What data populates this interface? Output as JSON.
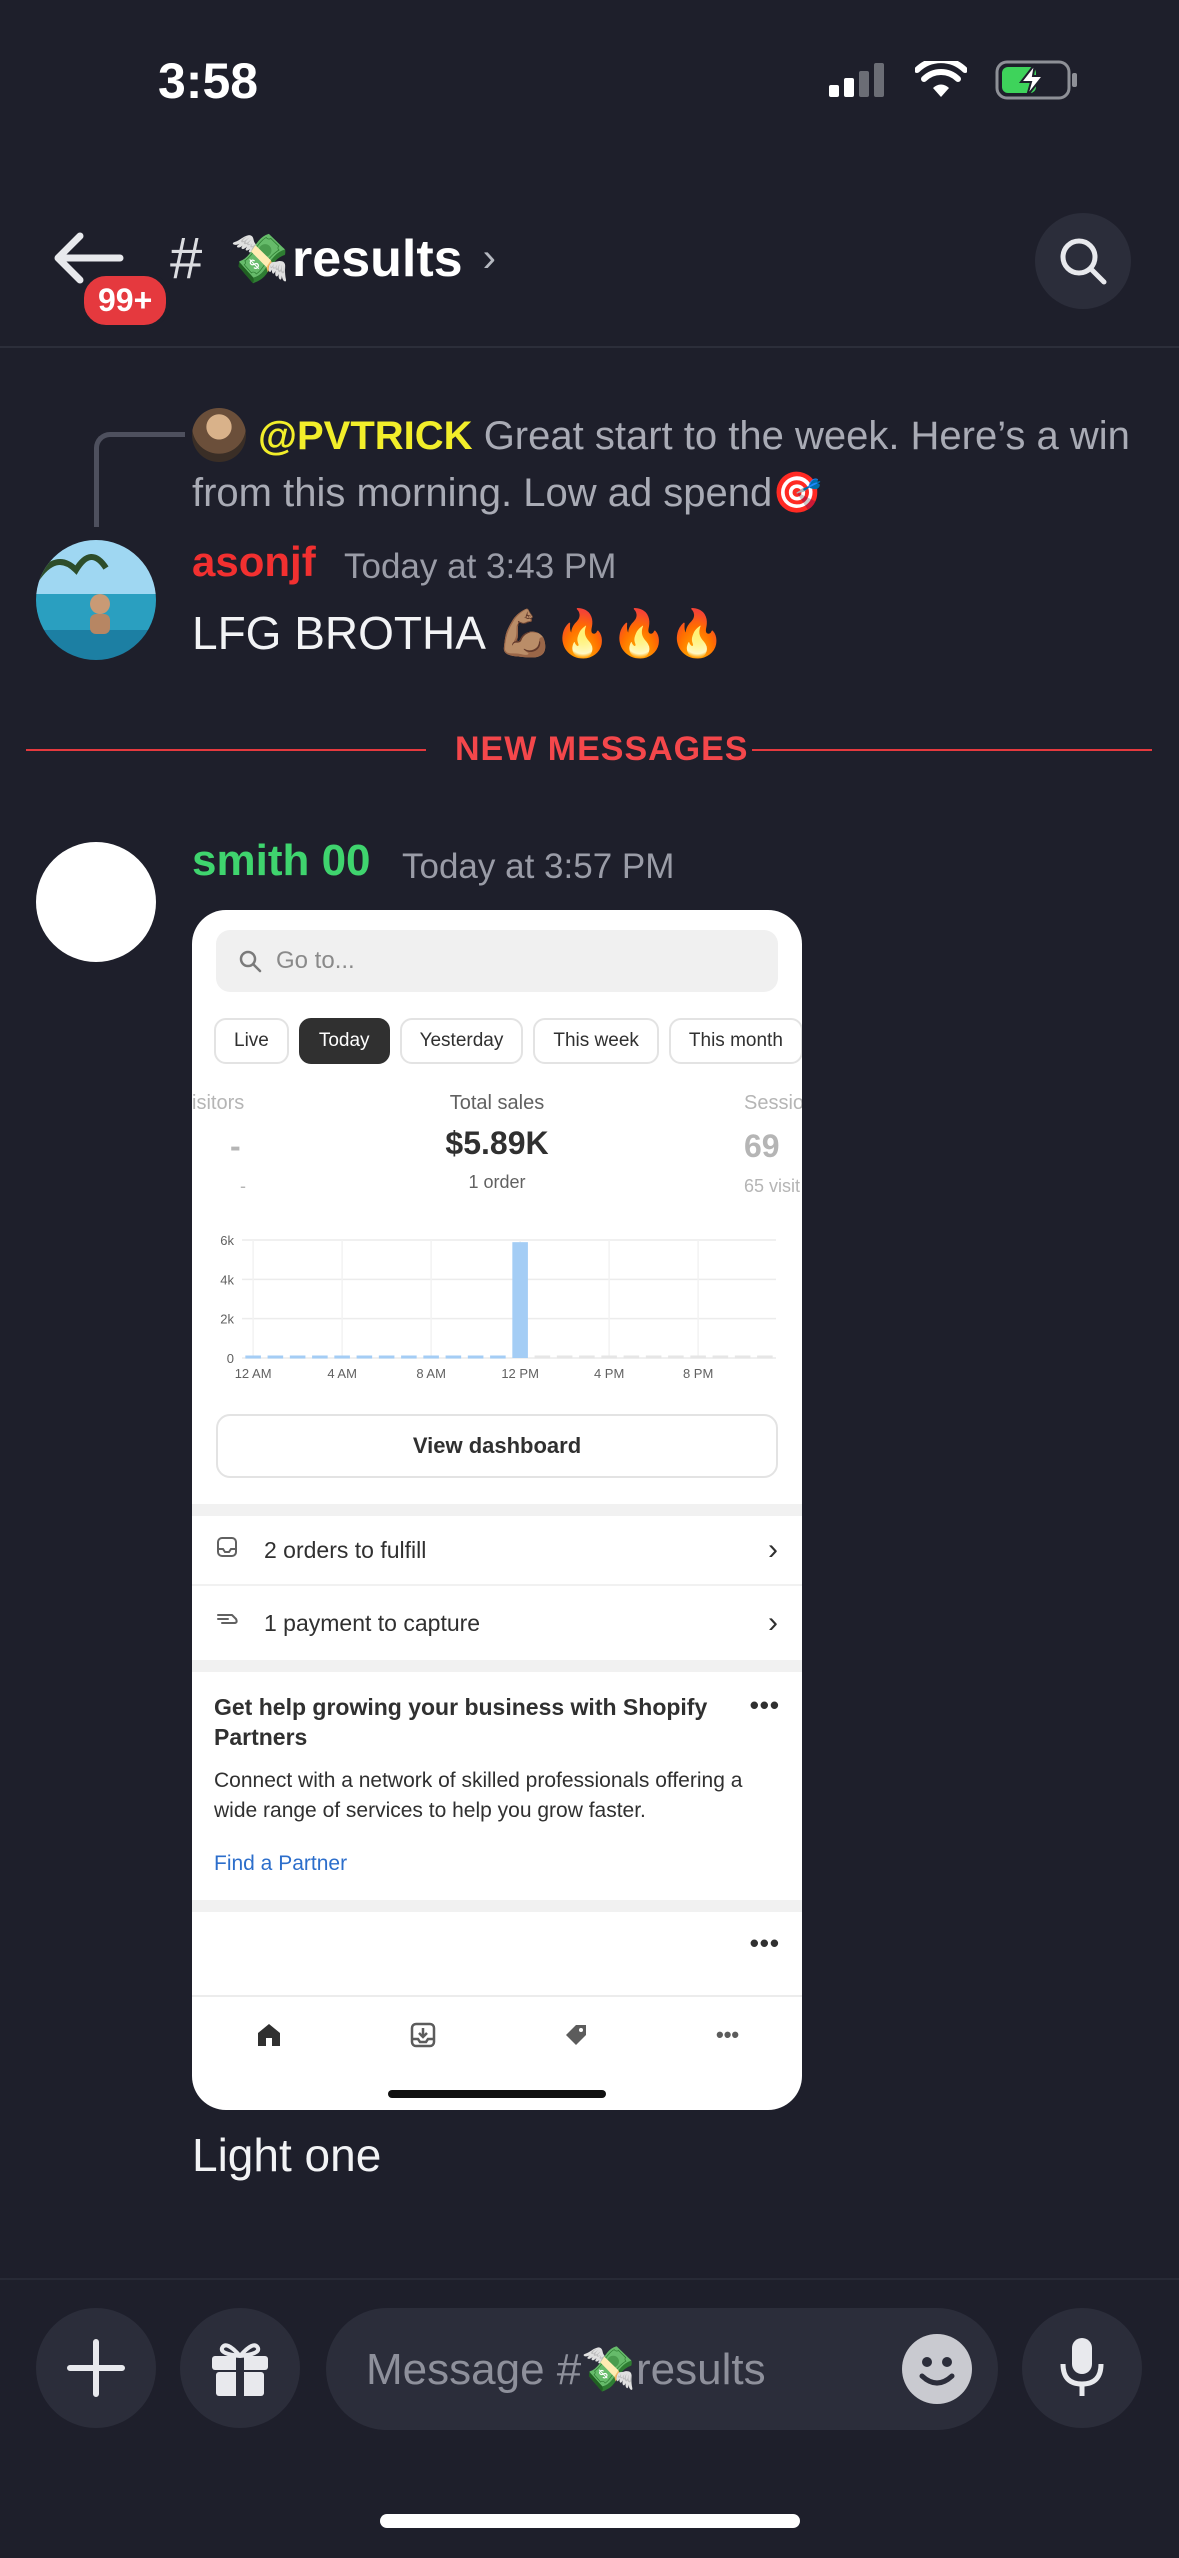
{
  "status_bar": {
    "time": "3:58"
  },
  "header": {
    "unread_badge": "99+",
    "channel_hash": "#",
    "channel_emoji": "💸",
    "channel_name": "results",
    "chevron": "›"
  },
  "reply": {
    "mention": "@PVTRICK",
    "text": " Great start to the week. Here’s a win from this morning. Low ad spend🎯"
  },
  "messages": [
    {
      "author": "asonjf",
      "author_color": "#f23030",
      "timestamp": "Today at 3:43 PM",
      "text": "LFG BROTHA 💪🏽🔥🔥🔥"
    },
    {
      "author": "smith 00",
      "author_color": "#3fd46e",
      "timestamp": "Today at 3:57 PM",
      "text": "Light one"
    }
  ],
  "divider": {
    "label": "NEW MESSAGES"
  },
  "screenshot": {
    "search_placeholder": "Go to...",
    "tabs": [
      "Live",
      "Today",
      "Yesterday",
      "This week",
      "This month"
    ],
    "active_tab": "Today",
    "metrics": [
      {
        "label": "isitors",
        "value": "-",
        "sub": "-"
      },
      {
        "label": "Total sales",
        "value": "$5.89K",
        "sub": "1 order"
      },
      {
        "label": "Sessio",
        "value": "69",
        "sub": "65 visit"
      }
    ],
    "view_dashboard": "View dashboard",
    "tasks": [
      {
        "icon": "inbox-icon",
        "label": "2 orders to fulfill"
      },
      {
        "icon": "payment-icon",
        "label": "1 payment to capture"
      }
    ],
    "card": {
      "title": "Get help growing your business with Shopify Partners",
      "body": "Connect with a network of skilled professionals offering a wide range of services to help you grow faster.",
      "link": "Find a Partner",
      "menu": "•••"
    },
    "bottom_menu": "•••",
    "tab_icons": [
      "home-icon",
      "orders-icon",
      "tag-icon",
      "more-icon"
    ]
  },
  "chart_data": {
    "type": "bar",
    "title": "",
    "xlabel": "",
    "ylabel": "",
    "ylim": [
      0,
      6000
    ],
    "y_ticks": [
      "0",
      "2k",
      "4k",
      "6k"
    ],
    "x_ticks": [
      "12 AM",
      "4 AM",
      "8 AM",
      "12 PM",
      "4 PM",
      "8 PM"
    ],
    "categories": [
      "12 AM",
      "1 AM",
      "2 AM",
      "3 AM",
      "4 AM",
      "5 AM",
      "6 AM",
      "7 AM",
      "8 AM",
      "9 AM",
      "10 AM",
      "11 AM",
      "12 PM",
      "1 PM",
      "2 PM",
      "3 PM",
      "4 PM",
      "5 PM",
      "6 PM",
      "7 PM",
      "8 PM",
      "9 PM",
      "10 PM",
      "11 PM"
    ],
    "values": [
      0,
      0,
      0,
      0,
      0,
      0,
      0,
      0,
      0,
      0,
      0,
      0,
      5890,
      0,
      0,
      0,
      0,
      0,
      0,
      0,
      0,
      0,
      0,
      0
    ],
    "bar_color": "#a4cdf5",
    "grid": true
  },
  "composer": {
    "placeholder": "Message #💸results"
  }
}
